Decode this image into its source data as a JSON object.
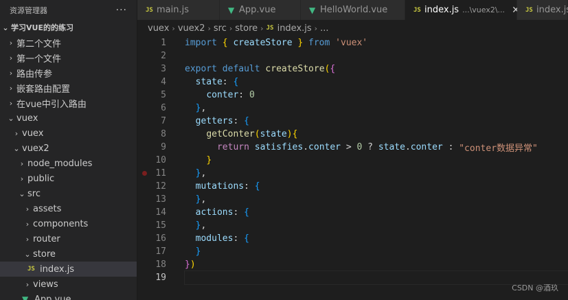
{
  "sidebar": {
    "title": "资源管理器",
    "more_label": "···",
    "project": "学习VUE的的练习",
    "items": [
      {
        "label": "第二个文件",
        "chevron": "›",
        "indent": 8
      },
      {
        "label": "第一个文件",
        "chevron": "›",
        "indent": 8
      },
      {
        "label": "路由传参",
        "chevron": "›",
        "indent": 8
      },
      {
        "label": "嵌套路由配置",
        "chevron": "›",
        "indent": 8
      },
      {
        "label": "在vue中引入路由",
        "chevron": "›",
        "indent": 8
      },
      {
        "label": "vuex",
        "chevron": "⌄",
        "indent": 8
      },
      {
        "label": "vuex",
        "chevron": "›",
        "indent": 16
      },
      {
        "label": "vuex2",
        "chevron": "⌄",
        "indent": 16
      },
      {
        "label": "node_modules",
        "chevron": "›",
        "indent": 24
      },
      {
        "label": "public",
        "chevron": "›",
        "indent": 24
      },
      {
        "label": "src",
        "chevron": "⌄",
        "indent": 24
      },
      {
        "label": "assets",
        "chevron": "›",
        "indent": 32
      },
      {
        "label": "components",
        "chevron": "›",
        "indent": 32
      },
      {
        "label": "router",
        "chevron": "›",
        "indent": 32
      },
      {
        "label": "store",
        "chevron": "⌄",
        "indent": 32
      },
      {
        "label": "index.js",
        "badge": "JS",
        "indent": 40,
        "selected": true
      },
      {
        "label": "views",
        "chevron": "›",
        "indent": 32
      },
      {
        "label": "App.vue",
        "badge": "V",
        "indent": 32
      }
    ]
  },
  "tabs": [
    {
      "label": "main.js",
      "badge": "JS"
    },
    {
      "label": "App.vue",
      "badge": "V"
    },
    {
      "label": "HelloWorld.vue",
      "badge": "V"
    },
    {
      "label": "index.js",
      "badge": "JS",
      "path": "...\\vuex2\\...",
      "close": "✕",
      "active": true
    },
    {
      "label": "index.js",
      "badge": "JS"
    }
  ],
  "breadcrumb": {
    "parts": [
      "vuex",
      "vuex2",
      "src",
      "store"
    ],
    "file_badge": "JS",
    "file": "index.js",
    "tail": "..."
  },
  "code": {
    "lines": [
      {
        "n": "1",
        "tokens": [
          [
            "k",
            "import"
          ],
          [
            "p",
            " "
          ],
          [
            "b1",
            "{"
          ],
          [
            "p",
            " "
          ],
          [
            "v",
            "createStore"
          ],
          [
            "p",
            " "
          ],
          [
            "b1",
            "}"
          ],
          [
            "p",
            " "
          ],
          [
            "k",
            "from"
          ],
          [
            "p",
            " "
          ],
          [
            "s",
            "'vuex'"
          ]
        ]
      },
      {
        "n": "2",
        "tokens": []
      },
      {
        "n": "3",
        "tokens": [
          [
            "k",
            "export"
          ],
          [
            "p",
            " "
          ],
          [
            "k",
            "default"
          ],
          [
            "p",
            " "
          ],
          [
            "fn",
            "createStore"
          ],
          [
            "b1",
            "("
          ],
          [
            "b2",
            "{"
          ]
        ]
      },
      {
        "n": "4",
        "tokens": [
          [
            "p",
            "  "
          ],
          [
            "v",
            "state"
          ],
          [
            "p",
            ": "
          ],
          [
            "b3",
            "{"
          ]
        ]
      },
      {
        "n": "5",
        "tokens": [
          [
            "p",
            "    "
          ],
          [
            "v",
            "conter"
          ],
          [
            "p",
            ": "
          ],
          [
            "n",
            "0"
          ]
        ]
      },
      {
        "n": "6",
        "tokens": [
          [
            "p",
            "  "
          ],
          [
            "b3",
            "}"
          ],
          [
            "p",
            ","
          ]
        ]
      },
      {
        "n": "7",
        "tokens": [
          [
            "p",
            "  "
          ],
          [
            "v",
            "getters"
          ],
          [
            "p",
            ": "
          ],
          [
            "b3",
            "{"
          ]
        ]
      },
      {
        "n": "8",
        "tokens": [
          [
            "p",
            "    "
          ],
          [
            "fn",
            "getConter"
          ],
          [
            "b1",
            "("
          ],
          [
            "v",
            "state"
          ],
          [
            "b1",
            ")"
          ],
          [
            "b1",
            "{"
          ]
        ]
      },
      {
        "n": "9",
        "tokens": [
          [
            "p",
            "      "
          ],
          [
            "kc",
            "return"
          ],
          [
            "p",
            " "
          ],
          [
            "v",
            "satisfies"
          ],
          [
            "p",
            "."
          ],
          [
            "v",
            "conter"
          ],
          [
            "p",
            " > "
          ],
          [
            "n",
            "0"
          ],
          [
            "p",
            " ? "
          ],
          [
            "v",
            "state"
          ],
          [
            "p",
            "."
          ],
          [
            "v",
            "conter"
          ],
          [
            "p",
            " : "
          ],
          [
            "s",
            "\"conter数据异常\""
          ]
        ]
      },
      {
        "n": "10",
        "tokens": [
          [
            "p",
            "    "
          ],
          [
            "b1",
            "}"
          ]
        ]
      },
      {
        "n": "11",
        "tokens": [
          [
            "p",
            "  "
          ],
          [
            "b3",
            "}"
          ],
          [
            "p",
            ","
          ]
        ],
        "breakpoint": true
      },
      {
        "n": "12",
        "tokens": [
          [
            "p",
            "  "
          ],
          [
            "v",
            "mutations"
          ],
          [
            "p",
            ": "
          ],
          [
            "b3",
            "{"
          ]
        ]
      },
      {
        "n": "13",
        "tokens": [
          [
            "p",
            "  "
          ],
          [
            "b3",
            "}"
          ],
          [
            "p",
            ","
          ]
        ]
      },
      {
        "n": "14",
        "tokens": [
          [
            "p",
            "  "
          ],
          [
            "v",
            "actions"
          ],
          [
            "p",
            ": "
          ],
          [
            "b3",
            "{"
          ]
        ]
      },
      {
        "n": "15",
        "tokens": [
          [
            "p",
            "  "
          ],
          [
            "b3",
            "}"
          ],
          [
            "p",
            ","
          ]
        ]
      },
      {
        "n": "16",
        "tokens": [
          [
            "p",
            "  "
          ],
          [
            "v",
            "modules"
          ],
          [
            "p",
            ": "
          ],
          [
            "b3",
            "{"
          ]
        ]
      },
      {
        "n": "17",
        "tokens": [
          [
            "p",
            "  "
          ],
          [
            "b3",
            "}"
          ]
        ]
      },
      {
        "n": "18",
        "tokens": [
          [
            "b2",
            "}"
          ],
          [
            "b1",
            ")"
          ]
        ]
      },
      {
        "n": "19",
        "tokens": [],
        "current": true
      }
    ]
  },
  "watermark": "CSDN @酒玖",
  "colors": {
    "background": "#1e1e1e",
    "sidebar": "#252526",
    "keyword": "#569cd6",
    "control_keyword": "#c586c0",
    "function": "#dcdcaa",
    "variable": "#9cdcfe",
    "string": "#ce9178",
    "number": "#b5cea8",
    "js_badge": "#cbcb41",
    "vue_badge": "#41b883"
  }
}
